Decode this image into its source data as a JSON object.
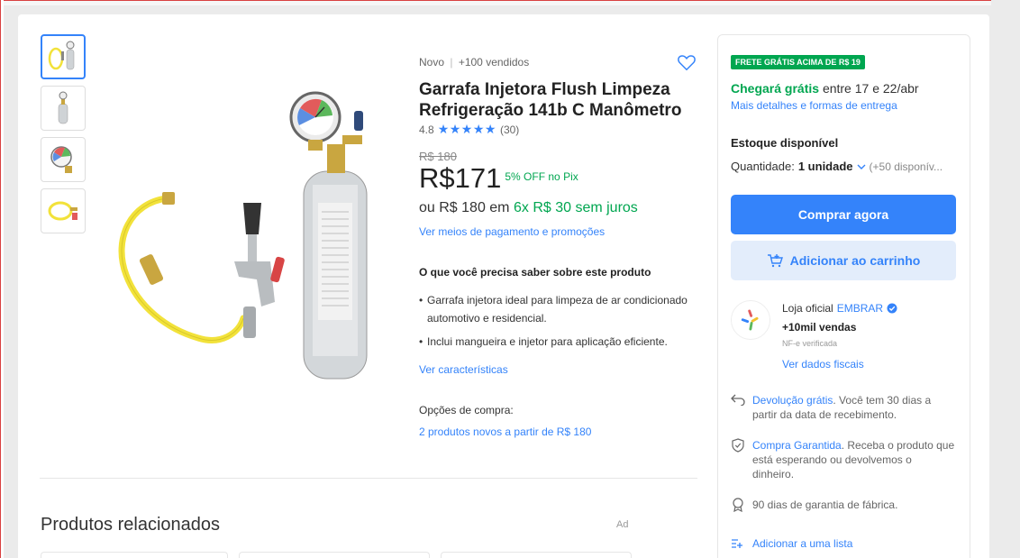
{
  "gallery": {
    "thumbnails": [
      "Produto completo",
      "Garrafa injetora",
      "Manômetro",
      "Mangueira amarela"
    ]
  },
  "product": {
    "condition": "Novo",
    "separator": "|",
    "sold": "+100 vendidos",
    "title": "Garrafa Injetora Flush Limpeza Refrigeração 141b C Manômetro",
    "rating_value": "4.8",
    "stars": "★★★★★",
    "rating_count": "(30)",
    "old_price": "R$ 180",
    "currency": "R$",
    "price": "171",
    "discount": "5% OFF no Pix",
    "install_prefix": "ou R$ 180 em",
    "install_green": "6x R$ 30 sem juros",
    "payment_link": "Ver meios de pagamento e promoções",
    "know_title": "O que você precisa saber sobre este produto",
    "bullets": [
      "Garrafa injetora ideal para limpeza de ar condicionado automotivo e residencial.",
      "Inclui mangueira e injetor para aplicação eficiente."
    ],
    "see_characteristics": "Ver características",
    "buy_options_title": "Opções de compra:",
    "buy_options_link": "2 produtos novos a partir de R$ 180"
  },
  "related": {
    "title": "Produtos relacionados",
    "ad": "Ad"
  },
  "sidebar": {
    "free_shipping_badge": "FRETE GRÁTIS ACIMA DE R$ 19",
    "arrives_green": "Chegará grátis",
    "arrives_rest": "entre 17 e 22/abr",
    "delivery_link": "Mais detalhes e formas de entrega",
    "stock_title": "Estoque disponível",
    "qty_label": "Quantidade:",
    "qty_value": "1 unidade",
    "qty_available": "(+50 disponív...",
    "buy_now": "Comprar agora",
    "add_to_cart": "Adicionar ao carrinho",
    "store_prefix": "Loja oficial",
    "store_name": "EMBRAR",
    "store_sales": "+10mil vendas",
    "store_nf": "NF-e verificada",
    "fiscal_link": "Ver dados fiscais",
    "return_link": "Devolução grátis",
    "return_text": ". Você tem 30 dias a partir da data de recebimento.",
    "guarantee_link": "Compra Garantida",
    "guarantee_text": ". Receba o produto que está esperando ou devolvemos o dinheiro.",
    "warranty": "90 dias de garantia de fábrica.",
    "add_list": "Adicionar a uma lista"
  },
  "colors": {
    "accent": "#3483fa",
    "green": "#00a650",
    "hose": "#f2e23a"
  }
}
